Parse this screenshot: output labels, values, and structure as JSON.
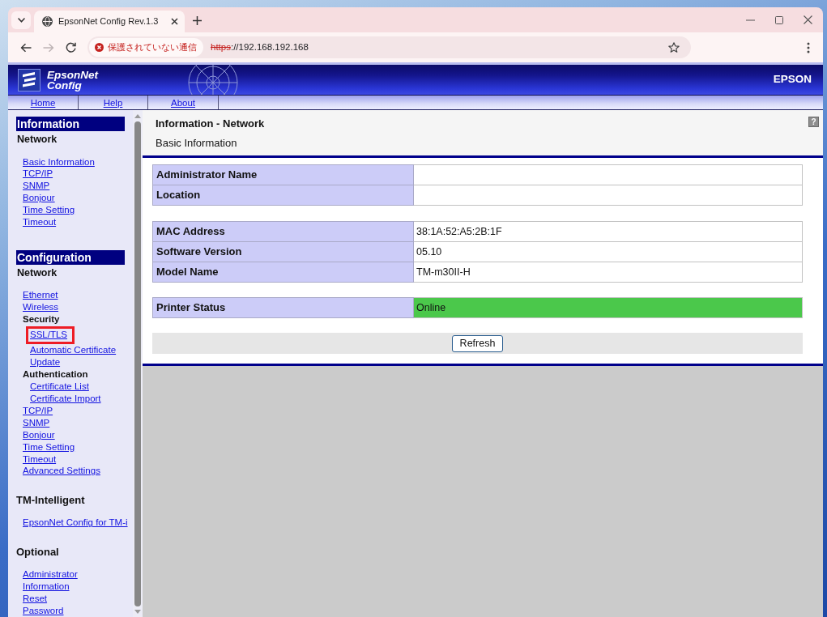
{
  "browser": {
    "tabs": [
      {
        "title": "EpsonNet Config Rev.1.3",
        "selected": true
      }
    ],
    "nav_buttons": [
      {
        "kind": "back",
        "disabled": false
      },
      {
        "kind": "forward",
        "disabled": true
      },
      {
        "kind": "reload",
        "disabled": false
      }
    ],
    "security": {
      "label": "保護されていない通信",
      "secure": false
    },
    "url": {
      "scheme": "https",
      "rest": "://192.168.192.168"
    }
  },
  "banner": {
    "logo": [
      "EpsonNet",
      "Config"
    ],
    "brand": "EPSON"
  },
  "nav": [
    {
      "label": "Home"
    },
    {
      "label": "Help"
    },
    {
      "label": "About"
    }
  ],
  "sidebar": {
    "sections": [
      {
        "kind": "banner",
        "title": "Information",
        "items": [
          {
            "kind": "heading",
            "label": "Network"
          },
          {
            "kind": "link",
            "label": "Basic Information",
            "highlighted": false
          },
          {
            "kind": "link",
            "label": "TCP/IP",
            "highlighted": false
          },
          {
            "kind": "link",
            "label": "SNMP",
            "highlighted": false
          },
          {
            "kind": "link",
            "label": "Bonjour",
            "highlighted": false
          },
          {
            "kind": "link",
            "label": "Time Setting",
            "highlighted": false
          },
          {
            "kind": "link",
            "label": "Timeout",
            "highlighted": false
          }
        ]
      },
      {
        "kind": "banner",
        "title": "Configuration",
        "items": [
          {
            "kind": "heading",
            "label": "Network"
          },
          {
            "kind": "link",
            "label": "Ethernet",
            "highlighted": false
          },
          {
            "kind": "link",
            "label": "Wireless",
            "highlighted": false
          },
          {
            "kind": "subheading",
            "label": "Security",
            "children": [
              {
                "kind": "link",
                "label": "SSL/TLS",
                "highlighted": true
              },
              {
                "kind": "link",
                "label": "Automatic Certificate Update",
                "highlighted": false
              }
            ]
          },
          {
            "kind": "subheading",
            "label": "Authentication",
            "children": [
              {
                "kind": "link",
                "label": "Certificate List",
                "highlighted": false
              },
              {
                "kind": "link",
                "label": "Certificate Import",
                "highlighted": false
              }
            ]
          },
          {
            "kind": "link",
            "label": "TCP/IP",
            "highlighted": false
          },
          {
            "kind": "link",
            "label": "SNMP",
            "highlighted": false
          },
          {
            "kind": "link",
            "label": "Bonjour",
            "highlighted": false
          },
          {
            "kind": "link",
            "label": "Time Setting",
            "highlighted": false
          },
          {
            "kind": "link",
            "label": "Timeout",
            "highlighted": false
          },
          {
            "kind": "link",
            "label": "Advanced Settings",
            "highlighted": false
          }
        ]
      },
      {
        "kind": "plain",
        "title": "TM-Intelligent",
        "items": [
          {
            "kind": "link",
            "label": "EpsonNet Config for TM-i",
            "highlighted": false
          }
        ]
      },
      {
        "kind": "plain",
        "title": "Optional",
        "items": [
          {
            "kind": "link",
            "label": "Administrator",
            "highlighted": false
          },
          {
            "kind": "link",
            "label": "Information",
            "highlighted": false
          },
          {
            "kind": "link",
            "label": "Reset",
            "highlighted": false
          },
          {
            "kind": "link",
            "label": "Password",
            "highlighted": false
          }
        ]
      }
    ]
  },
  "page": {
    "title": "Information - Network",
    "subtitle": "Basic Information",
    "help": "?",
    "tables": [
      {
        "rows": [
          {
            "label": "Administrator Name"
          },
          {
            "label": "Location"
          }
        ]
      },
      {
        "rows": [
          {
            "label": "MAC Address",
            "value": "38:1A:52:A5:2B:1F"
          },
          {
            "label": "Software Version",
            "value": "05.10"
          },
          {
            "label": "Model Name",
            "value": "TM-m30II-H"
          }
        ]
      },
      {
        "rows": [
          {
            "label": "Printer Status",
            "value": "Online",
            "color": "#4bc84b"
          }
        ]
      }
    ],
    "buttons": [
      "Refresh"
    ]
  }
}
